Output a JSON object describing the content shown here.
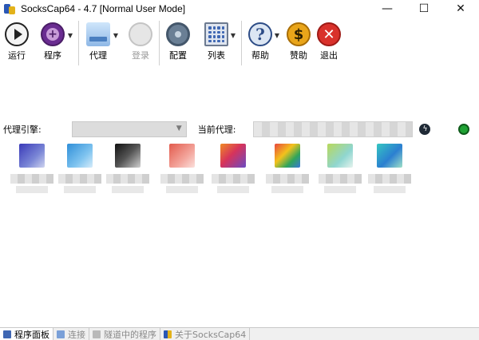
{
  "window": {
    "title": "SocksCap64 - 4.7 [Normal User Mode]",
    "controls": {
      "minimize": "—",
      "maximize": "☐",
      "close": "✕"
    }
  },
  "toolbar": {
    "run_label": "运行",
    "programs_label": "程序",
    "proxy_label": "代理",
    "login_label": "登录",
    "config_label": "配置",
    "list_label": "列表",
    "help_label": "帮助",
    "donate_label": "赞助",
    "exit_label": "退出",
    "icons": {
      "run": "play-icon",
      "programs": "add-program-icon",
      "proxy": "proxy-icon",
      "login": "login-icon",
      "config": "gear-icon",
      "list": "grid-list-icon",
      "help": "help-icon",
      "donate": "dollar-icon",
      "exit": "exit-icon"
    }
  },
  "proxybar": {
    "engine_label": "代理引擎:",
    "current_label": "当前代理:",
    "status_color": "#1fa234"
  },
  "tabs": [
    {
      "label": "程序面板",
      "active": true
    },
    {
      "label": "连接",
      "active": false
    },
    {
      "label": "隧道中的程序",
      "active": false
    },
    {
      "label": "关于SocksCap64",
      "active": false
    }
  ]
}
